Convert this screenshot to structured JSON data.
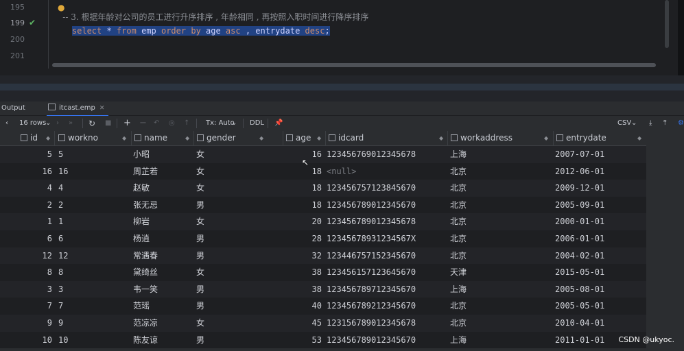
{
  "editor": {
    "lines": [
      {
        "no": "195",
        "text": "-- 3. 根据年龄对公司的员工进行升序排序 , 年龄相同 , 再按照入职时间进行降序排序"
      },
      {
        "no": "199",
        "text": "select * from emp order by age asc , entrydate desc;"
      },
      {
        "no": "200",
        "text": ""
      },
      {
        "no": "201",
        "text": ""
      }
    ],
    "sql_tokens": [
      {
        "t": "select",
        "kw": true
      },
      {
        "t": " * ",
        "kw": false
      },
      {
        "t": "from",
        "kw": true
      },
      {
        "t": " emp ",
        "kw": false
      },
      {
        "t": "order",
        "kw": true
      },
      {
        "t": " ",
        "kw": false
      },
      {
        "t": "by",
        "kw": true
      },
      {
        "t": " age ",
        "kw": false
      },
      {
        "t": "asc",
        "kw": true
      },
      {
        "t": " , entrydate ",
        "kw": false
      },
      {
        "t": "desc",
        "kw": true
      },
      {
        "t": ";",
        "kw": false
      }
    ]
  },
  "tabs": [
    {
      "label": "Output"
    },
    {
      "label": "itcast.emp"
    }
  ],
  "toolbar": {
    "rows_label": "16 rows",
    "tx_label": "Tx: Auto",
    "ddl_label": "DDL",
    "export_label": "CSV"
  },
  "table": {
    "columns": [
      "id",
      "workno",
      "name",
      "gender",
      "age",
      "idcard",
      "workaddress",
      "entrydate"
    ],
    "rows": [
      [
        "5",
        "5",
        "小昭",
        "女",
        "16",
        "123456769012345678",
        "上海",
        "2007-07-01"
      ],
      [
        "16",
        "16",
        "周芷若",
        "女",
        "18",
        "<null>",
        "北京",
        "2012-06-01"
      ],
      [
        "4",
        "4",
        "赵敏",
        "女",
        "18",
        "123456757123845670",
        "北京",
        "2009-12-01"
      ],
      [
        "2",
        "2",
        "张无忌",
        "男",
        "18",
        "123456789012345670",
        "北京",
        "2005-09-01"
      ],
      [
        "1",
        "1",
        "柳岩",
        "女",
        "20",
        "123456789012345678",
        "北京",
        "2000-01-01"
      ],
      [
        "6",
        "6",
        "杨逍",
        "男",
        "28",
        "12345678931234567X",
        "北京",
        "2006-01-01"
      ],
      [
        "12",
        "12",
        "常遇春",
        "男",
        "32",
        "123446757152345670",
        "北京",
        "2004-02-01"
      ],
      [
        "8",
        "8",
        "黛绮丝",
        "女",
        "38",
        "123456157123645670",
        "天津",
        "2015-05-01"
      ],
      [
        "3",
        "3",
        "韦一笑",
        "男",
        "38",
        "123456789712345670",
        "上海",
        "2005-08-01"
      ],
      [
        "7",
        "7",
        "范瑶",
        "男",
        "40",
        "123456789212345670",
        "北京",
        "2005-05-01"
      ],
      [
        "9",
        "9",
        "范凉凉",
        "女",
        "45",
        "123156789012345678",
        "北京",
        "2010-04-01"
      ],
      [
        "10",
        "10",
        "陈友谅",
        "男",
        "53",
        "123456789012345670",
        "上海",
        "2011-01-01"
      ]
    ]
  },
  "watermark": "CSDN @ukyoc."
}
